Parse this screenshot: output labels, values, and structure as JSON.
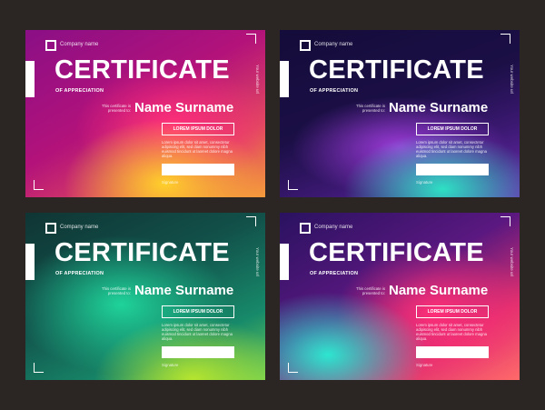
{
  "certificates": [
    {
      "company": "Company name",
      "title": "CERTIFICATE",
      "subtitle": "OF APPRECIATION",
      "presented_to": "This certificate is presented to:",
      "name": "Name Surname",
      "badge": "LOREM IPSUM DOLOR",
      "body": "Lorem ipsum dolor sit amet, consectetur adipiscing elit, sed diam nonummy nibh euismod tincidunt ut laoreet dolore magna aliqua.",
      "signature_label": "Signature",
      "vertical_text": "Your website url"
    },
    {
      "company": "Company name",
      "title": "CERTIFICATE",
      "subtitle": "OF APPRECIATION",
      "presented_to": "This certificate is presented to:",
      "name": "Name Surname",
      "badge": "LOREM IPSUM DOLOR",
      "body": "Lorem ipsum dolor sit amet, consectetur adipiscing elit, sed diam nonummy nibh euismod tincidunt ut laoreet dolore magna aliqua.",
      "signature_label": "Signature",
      "vertical_text": "Your website url"
    },
    {
      "company": "Company name",
      "title": "CERTIFICATE",
      "subtitle": "OF APPRECIATION",
      "presented_to": "This certificate is presented to:",
      "name": "Name Surname",
      "badge": "LOREM IPSUM DOLOR",
      "body": "Lorem ipsum dolor sit amet, consectetur adipiscing elit, sed diam nonummy nibh euismod tincidunt ut laoreet dolore magna aliqua.",
      "signature_label": "Signature",
      "vertical_text": "Your website url"
    },
    {
      "company": "Company name",
      "title": "CERTIFICATE",
      "subtitle": "OF APPRECIATION",
      "presented_to": "This certificate is presented to:",
      "name": "Name Surname",
      "badge": "LOREM IPSUM DOLOR",
      "body": "Lorem ipsum dolor sit amet, consectetur adipiscing elit, sed diam nonummy nibh euismod tincidunt ut laoreet dolore magna aliqua.",
      "signature_label": "Signature",
      "vertical_text": "Your website url"
    }
  ],
  "colors": {
    "background": "#2b2624",
    "accent_text": "#ffffff"
  }
}
